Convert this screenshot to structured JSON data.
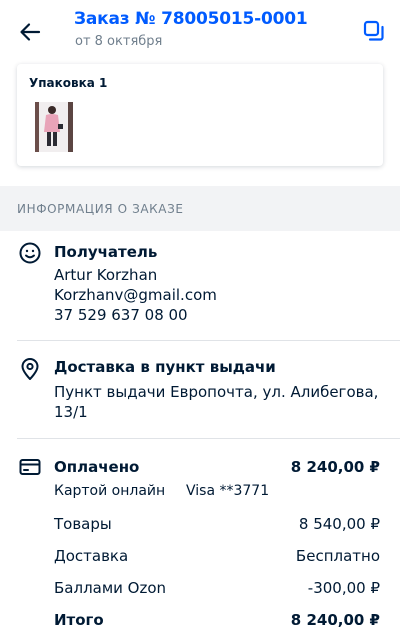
{
  "header": {
    "title": "Заказ № 78005015-0001",
    "subtitle": "от 8 октября"
  },
  "package": {
    "title": "Упаковка 1"
  },
  "section": {
    "title": "ИНФОРМАЦИЯ О ЗАКАЗЕ"
  },
  "recipient": {
    "heading": "Получатель",
    "name": "Artur Korzhan",
    "email": "Korzhanv@gmail.com",
    "phone": "37 529 637 08 00"
  },
  "delivery": {
    "heading": "Доставка в пункт выдачи",
    "address_line1": "Пункт выдачи Европочта, ул. Алибегова,",
    "address_line2": "13/1"
  },
  "payment": {
    "heading": "Оплачено",
    "total_paid": "8 240,00 ₽",
    "method": "Картой онлайн",
    "card": "Visa **3771",
    "lines": [
      {
        "label": "Товары",
        "value": "8 540,00 ₽"
      },
      {
        "label": "Доставка",
        "value": "Бесплатно"
      },
      {
        "label": "Баллами Ozon",
        "value": "-300,00 ₽"
      }
    ],
    "total_label": "Итого",
    "total_value": "8 240,00 ₽"
  },
  "colors": {
    "accent": "#005bff",
    "text": "#001a34",
    "muted": "#707f8d",
    "section_bg": "#f2f3f5"
  }
}
